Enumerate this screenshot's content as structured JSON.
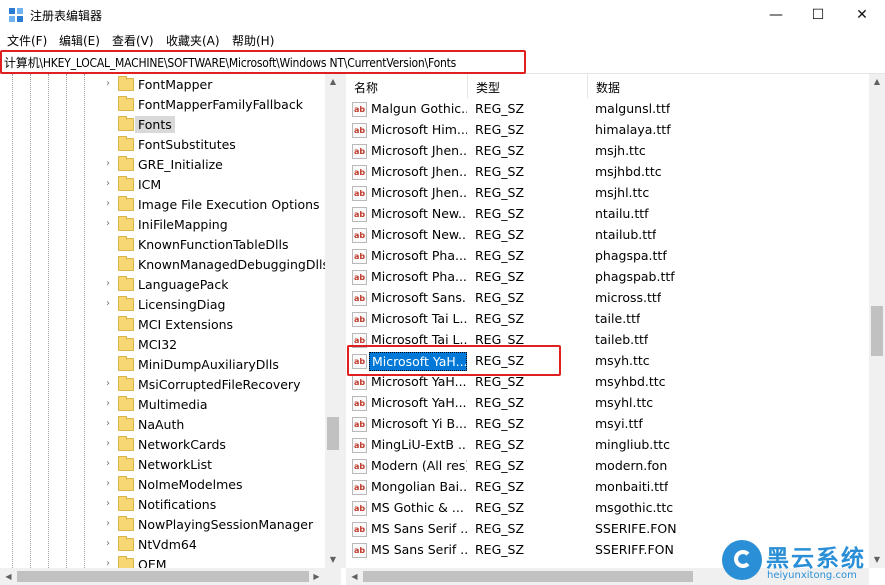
{
  "window": {
    "title": "注册表编辑器",
    "minimize_glyph": "—",
    "maximize_glyph": "☐",
    "close_glyph": "✕"
  },
  "menu": [
    "文件(F)",
    "编辑(E)",
    "查看(V)",
    "收藏夹(A)",
    "帮助(H)"
  ],
  "address": "计算机\\HKEY_LOCAL_MACHINE\\SOFTWARE\\Microsoft\\Windows NT\\CurrentVersion\\Fonts",
  "tree": {
    "items": [
      {
        "label": "FontMapper",
        "expandable": true
      },
      {
        "label": "FontMapperFamilyFallback",
        "expandable": false
      },
      {
        "label": "Fonts",
        "expandable": false,
        "selected": true
      },
      {
        "label": "FontSubstitutes",
        "expandable": false
      },
      {
        "label": "GRE_Initialize",
        "expandable": true
      },
      {
        "label": "ICM",
        "expandable": true
      },
      {
        "label": "Image File Execution Options",
        "expandable": true
      },
      {
        "label": "IniFileMapping",
        "expandable": true
      },
      {
        "label": "KnownFunctionTableDlls",
        "expandable": false
      },
      {
        "label": "KnownManagedDebuggingDlls",
        "expandable": false
      },
      {
        "label": "LanguagePack",
        "expandable": true
      },
      {
        "label": "LicensingDiag",
        "expandable": true
      },
      {
        "label": "MCI Extensions",
        "expandable": false
      },
      {
        "label": "MCI32",
        "expandable": false
      },
      {
        "label": "MiniDumpAuxiliaryDlls",
        "expandable": false
      },
      {
        "label": "MsiCorruptedFileRecovery",
        "expandable": true
      },
      {
        "label": "Multimedia",
        "expandable": true
      },
      {
        "label": "NaAuth",
        "expandable": true
      },
      {
        "label": "NetworkCards",
        "expandable": true
      },
      {
        "label": "NetworkList",
        "expandable": true
      },
      {
        "label": "NoImeModelmes",
        "expandable": true
      },
      {
        "label": "Notifications",
        "expandable": true
      },
      {
        "label": "NowPlayingSessionManager",
        "expandable": true
      },
      {
        "label": "NtVdm64",
        "expandable": true
      },
      {
        "label": "OEM",
        "expandable": true
      }
    ]
  },
  "list": {
    "headers": {
      "name": "名称",
      "type": "类型",
      "data": "数据"
    },
    "rows": [
      {
        "name": "Malgun Gothic...",
        "type": "REG_SZ",
        "data": "malgunsl.ttf"
      },
      {
        "name": "Microsoft Him...",
        "type": "REG_SZ",
        "data": "himalaya.ttf"
      },
      {
        "name": "Microsoft Jhen...",
        "type": "REG_SZ",
        "data": "msjh.ttc"
      },
      {
        "name": "Microsoft Jhen...",
        "type": "REG_SZ",
        "data": "msjhbd.ttc"
      },
      {
        "name": "Microsoft Jhen...",
        "type": "REG_SZ",
        "data": "msjhl.ttc"
      },
      {
        "name": "Microsoft New...",
        "type": "REG_SZ",
        "data": "ntailu.ttf"
      },
      {
        "name": "Microsoft New...",
        "type": "REG_SZ",
        "data": "ntailub.ttf"
      },
      {
        "name": "Microsoft Pha...",
        "type": "REG_SZ",
        "data": "phagspa.ttf"
      },
      {
        "name": "Microsoft Pha...",
        "type": "REG_SZ",
        "data": "phagspab.ttf"
      },
      {
        "name": "Microsoft Sans...",
        "type": "REG_SZ",
        "data": "micross.ttf"
      },
      {
        "name": "Microsoft Tai L...",
        "type": "REG_SZ",
        "data": "taile.ttf"
      },
      {
        "name": "Microsoft Tai L...",
        "type": "REG_SZ",
        "data": "taileb.ttf"
      },
      {
        "name": "Microsoft YaH...",
        "type": "REG_SZ",
        "data": "msyh.ttc",
        "selected": true
      },
      {
        "name": "Microsoft YaH...",
        "type": "REG_SZ",
        "data": "msyhbd.ttc"
      },
      {
        "name": "Microsoft YaH...",
        "type": "REG_SZ",
        "data": "msyhl.ttc"
      },
      {
        "name": "Microsoft Yi B...",
        "type": "REG_SZ",
        "data": "msyi.ttf"
      },
      {
        "name": "MingLiU-ExtB ...",
        "type": "REG_SZ",
        "data": "mingliub.ttc"
      },
      {
        "name": "Modern (All res)",
        "type": "REG_SZ",
        "data": "modern.fon"
      },
      {
        "name": "Mongolian Bai...",
        "type": "REG_SZ",
        "data": "monbaiti.ttf"
      },
      {
        "name": "MS Gothic & ...",
        "type": "REG_SZ",
        "data": "msgothic.ttc"
      },
      {
        "name": "MS Sans Serif ...",
        "type": "REG_SZ",
        "data": "SSERIFE.FON"
      },
      {
        "name": "MS Sans Serif ...",
        "type": "REG_SZ",
        "data": "SSERIFF.FON"
      }
    ]
  },
  "watermark": {
    "cn": "黑云系统",
    "en": "heiyunxitong.com"
  },
  "colors": {
    "highlight": "#e0201f",
    "selection": "#0078d7",
    "folder": "#f7d774"
  }
}
